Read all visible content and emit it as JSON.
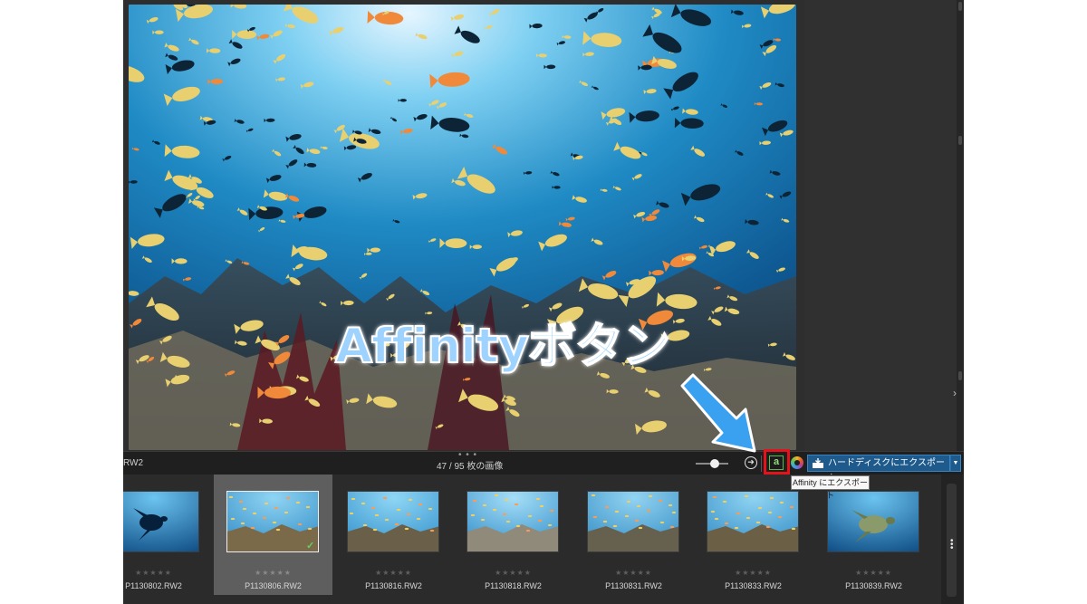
{
  "statusbar": {
    "filename_fragment": "RW2",
    "image_count": "47 / 95 枚の画像",
    "drag_handle": "• • •",
    "share_icon": "arrow-right-circle-icon",
    "affinity_icon": "affinity-photo-icon",
    "affinity_glyph": "a",
    "photos_icon": "apple-photos-icon",
    "export_button_label": "ハードディスクにエクスポート",
    "export_dropdown_glyph": "▼"
  },
  "tooltip": {
    "text": "Affinity にエクスポート"
  },
  "annotation": {
    "overlay_text": "Affinityボタン",
    "highlight_color": "#e3121b",
    "arrow_color": "#3aa0f0"
  },
  "right_panel": {
    "chevron": "›"
  },
  "filmstrip": {
    "selected_index": 1,
    "items": [
      {
        "filename": "P1130802.RW2",
        "stars": "★★★★★",
        "checked": false
      },
      {
        "filename": "P1130806.RW2",
        "stars": "★★★★★",
        "checked": true
      },
      {
        "filename": "P1130816.RW2",
        "stars": "★★★★★",
        "checked": false
      },
      {
        "filename": "P1130818.RW2",
        "stars": "★★★★★",
        "checked": false
      },
      {
        "filename": "P1130831.RW2",
        "stars": "★★★★★",
        "checked": false
      },
      {
        "filename": "P1130833.RW2",
        "stars": "★★★★★",
        "checked": false
      },
      {
        "filename": "P1130839.RW2",
        "stars": "★★★★★",
        "checked": false
      }
    ],
    "check_glyph": "✓",
    "scroll_dots": "•\n•\n•"
  },
  "colors": {
    "app_bg": "#2b2b2b",
    "accent_blue": "#1e5a8c",
    "selected_tile": "#5e5e5e"
  }
}
